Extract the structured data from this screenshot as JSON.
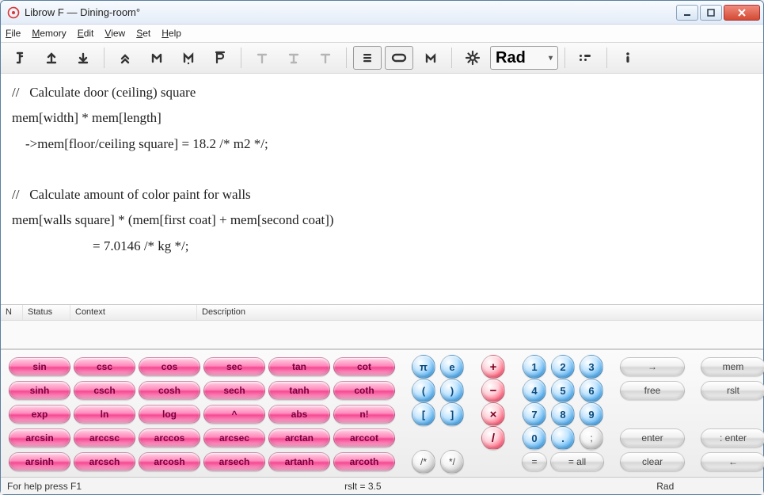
{
  "window": {
    "title": "Librow F — Dining-room°"
  },
  "menu": [
    "File",
    "Memory",
    "Edit",
    "View",
    "Set",
    "Help"
  ],
  "toolbar": {
    "angle_mode": "Rad"
  },
  "editor": {
    "lines": [
      "//   Calculate door (ceiling) square",
      "mem[width] * mem[length]",
      "    ->mem[floor/ceiling square] = 18.2 /* m2 */;",
      "",
      "//   Calculate amount of color paint for walls",
      "mem[walls square] * (mem[first coat] + mem[second coat])",
      "                        = 7.0146 /* kg */;"
    ]
  },
  "grid_headers": {
    "n": "N",
    "status": "Status",
    "context": "Context",
    "description": "Description"
  },
  "keypad": {
    "pink": [
      [
        "sin",
        "csc",
        "cos",
        "sec",
        "tan",
        "cot"
      ],
      [
        "sinh",
        "csch",
        "cosh",
        "sech",
        "tanh",
        "coth"
      ],
      [
        "exp",
        "ln",
        "log",
        "^",
        "abs",
        "n!"
      ],
      [
        "arcsin",
        "arccsc",
        "arccos",
        "arcsec",
        "arctan",
        "arccot"
      ],
      [
        "arsinh",
        "arcsch",
        "arcosh",
        "arsech",
        "artanh",
        "arcoth"
      ]
    ],
    "blueA": [
      [
        "π",
        "e"
      ],
      [
        "(",
        ")"
      ],
      [
        "[",
        "]"
      ],
      [
        "",
        ""
      ],
      [
        "",
        ""
      ]
    ],
    "red": [
      "+",
      "−",
      "×",
      "/",
      ""
    ],
    "digits": [
      [
        "1",
        "2",
        "3"
      ],
      [
        "4",
        "5",
        "6"
      ],
      [
        "7",
        "8",
        "9"
      ],
      [
        "0",
        ".",
        ""
      ],
      [
        "",
        "",
        ""
      ]
    ],
    "grayA": [
      "→",
      "free",
      "",
      "enter",
      "clear"
    ],
    "grayB": [
      "mem",
      "rslt",
      "",
      ": enter",
      "←"
    ],
    "row4_graycirc": ";",
    "row5_left": [
      "/*",
      "*/"
    ],
    "row5_mid": [
      "=",
      "= all"
    ]
  },
  "statusbar": {
    "help": "For help press F1",
    "rslt": "rslt = 3.5",
    "mode": "Rad"
  }
}
